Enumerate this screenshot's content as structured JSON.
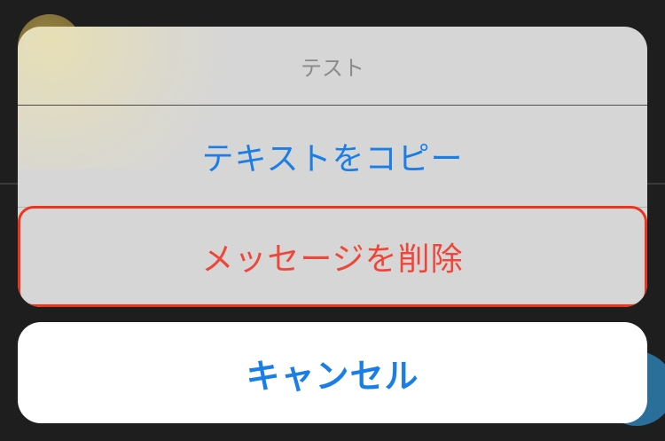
{
  "action_sheet": {
    "title": "テスト",
    "actions": [
      {
        "label": "テキストをコピー",
        "color": "#1a7ee8"
      },
      {
        "label": "メッセージを削除",
        "color": "#f0463a",
        "highlighted": true
      }
    ],
    "cancel_label": "キャンセル"
  },
  "colors": {
    "accent": "#1a7ee8",
    "destructive": "#f0463a",
    "highlight_border": "#f0331f",
    "sheet_background": "#d6d6d6",
    "screen_background": "#1e1e1e"
  }
}
